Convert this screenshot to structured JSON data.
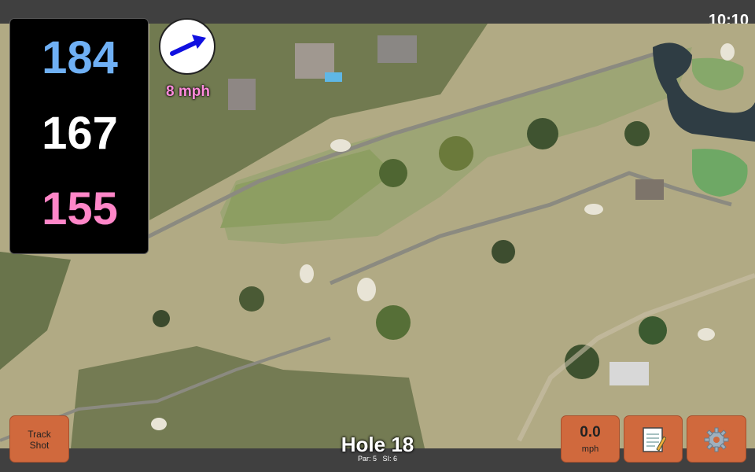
{
  "status": {
    "clock": "10:10"
  },
  "distances": {
    "back": "184",
    "middle": "167",
    "front": "155"
  },
  "wind": {
    "speed": "8 mph",
    "icon": "wind-direction-arrow-icon"
  },
  "hole": {
    "title": "Hole 18",
    "par": "Par: 5",
    "si": "SI: 6"
  },
  "buttons": {
    "track_line1": "Track",
    "track_line2": "Shot",
    "speed_value": "0.0",
    "speed_unit": "mph",
    "notes_icon": "notepad-icon",
    "settings_icon": "gear-icon"
  },
  "colors": {
    "back": "#6fb0f5",
    "middle": "#ffffff",
    "front": "#ff86c8",
    "button": "#d0693d"
  }
}
